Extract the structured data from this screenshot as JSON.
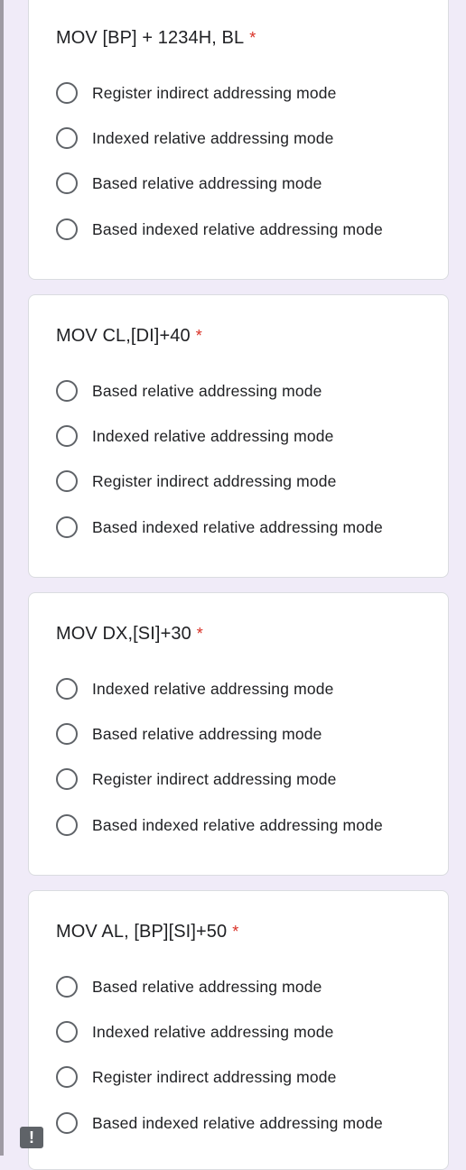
{
  "questions": [
    {
      "title": "MOV [BP] + 1234H, BL",
      "required_mark": "*",
      "options": [
        "Register indirect addressing mode",
        "Indexed relative addressing mode",
        "Based relative addressing mode",
        "Based indexed relative addressing mode"
      ]
    },
    {
      "title": "MOV CL,[DI]+40",
      "required_mark": "*",
      "options": [
        "Based relative addressing mode",
        "Indexed relative addressing mode",
        "Register indirect addressing mode",
        "Based indexed relative addressing mode"
      ]
    },
    {
      "title": "MOV DX,[SI]+30",
      "required_mark": "*",
      "options": [
        "Indexed relative addressing mode",
        "Based relative addressing mode",
        "Register indirect addressing mode",
        "Based indexed relative addressing mode"
      ]
    },
    {
      "title": "MOV AL, [BP][SI]+50",
      "required_mark": "*",
      "options": [
        "Based relative addressing mode",
        "Indexed relative addressing mode",
        "Register indirect addressing mode",
        "Based indexed relative addressing mode"
      ]
    }
  ],
  "report_icon": {
    "name": "report-problem-icon",
    "glyph": "!"
  },
  "colors": {
    "background": "#f0ebf8",
    "card": "#ffffff",
    "required": "#d93025",
    "text": "#202124"
  }
}
